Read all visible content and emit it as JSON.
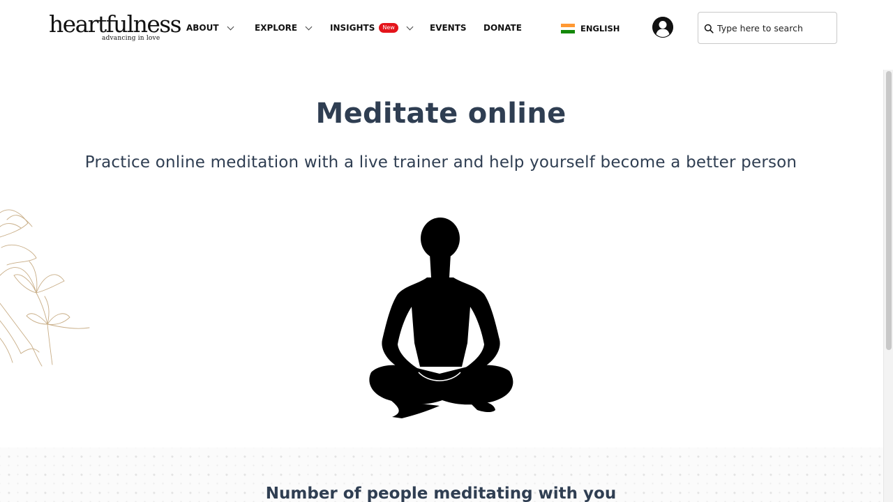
{
  "brand": {
    "name": "heartfulness",
    "tagline": "advancing in love"
  },
  "nav": {
    "about": "ABOUT",
    "explore": "EXPLORE",
    "insights": "INSIGHTS",
    "insights_badge": "New",
    "events": "EVENTS",
    "donate": "DONATE"
  },
  "language": {
    "label": "ENGLISH",
    "flag_colors": [
      "#ff9933",
      "#ffffff",
      "#138808"
    ]
  },
  "search": {
    "placeholder": "Type here to search",
    "value": ""
  },
  "icons": {
    "user": "user-avatar-icon",
    "search": "search-icon",
    "chevron": "chevron-down-icon"
  },
  "main": {
    "title": "Meditate online",
    "subtitle": "Practice online meditation with a live trainer and help yourself become a better person"
  },
  "section": {
    "title": "Number of people meditating with you"
  },
  "colors": {
    "heading": "#2f3e52",
    "badge": "#e4141b",
    "accent_floral": "#c8ad86"
  }
}
